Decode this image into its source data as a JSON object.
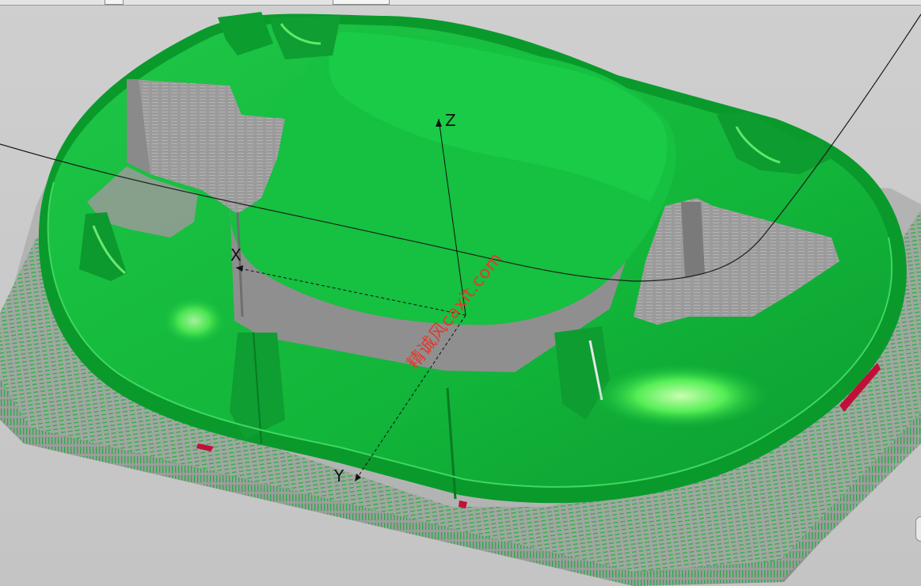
{
  "viewport": {
    "axes": {
      "x_label": "X",
      "y_label": "Y",
      "z_label": "Z"
    },
    "watermark": "精诚风caxit.com"
  },
  "colors": {
    "background": "#c9c9c9",
    "stock": "#a9a9a9",
    "model_green": "#14b83c",
    "model_highlight": "#5ee85c",
    "model_shadow": "#0a8a2a",
    "toolpath": "#1a1a1a",
    "watermark": "#e03a2e",
    "gouge": "#c0103a"
  },
  "icons": [
    "triad-icon"
  ]
}
